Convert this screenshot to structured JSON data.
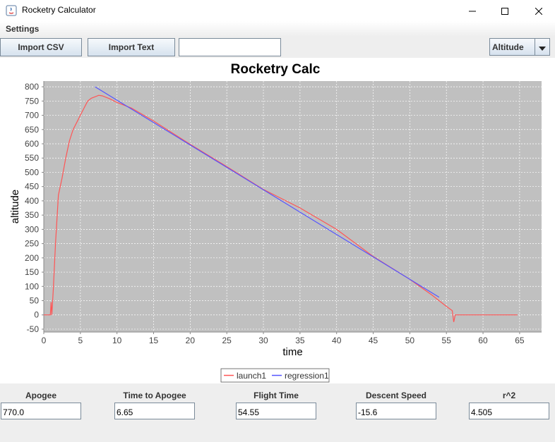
{
  "window": {
    "title": "Rocketry Calculator"
  },
  "menu": {
    "settings_label": "Settings"
  },
  "toolbar": {
    "import_csv_label": "Import CSV",
    "import_text_label": "Import Text",
    "text_value": "",
    "mode_selected": "Altitude"
  },
  "stats": [
    {
      "label": "Apogee",
      "value": "770.0"
    },
    {
      "label": "Time to Apogee",
      "value": "6.65"
    },
    {
      "label": "Flight Time",
      "value": "54.55"
    },
    {
      "label": "Descent Speed",
      "value": "-15.6"
    },
    {
      "label": "r^2",
      "value": "4.505"
    }
  ],
  "colors": {
    "plot_background": "#c0c0c0",
    "gridline": "#ffffff",
    "launch_series": "#ff5555",
    "regression_series": "#5555ff",
    "panel_bg": "#eeeeee"
  },
  "chart_data": {
    "type": "line",
    "title": "Rocketry Calc",
    "xlabel": "time",
    "ylabel": "altitude",
    "xlim": [
      0,
      68
    ],
    "ylim": [
      -60,
      820
    ],
    "xticks": [
      0,
      5,
      10,
      15,
      20,
      25,
      30,
      35,
      40,
      45,
      50,
      55,
      60,
      65
    ],
    "yticks": [
      -50,
      0,
      50,
      100,
      150,
      200,
      250,
      300,
      350,
      400,
      450,
      500,
      550,
      600,
      650,
      700,
      750,
      800
    ],
    "grid": true,
    "legend_position": "bottom-center",
    "series": [
      {
        "name": "launch1",
        "x": [
          0,
          0.9,
          1.0,
          1.1,
          1.3,
          1.6,
          2.0,
          2.5,
          3.0,
          3.5,
          4.0,
          4.5,
          5.0,
          5.5,
          6.0,
          6.5,
          7.0,
          7.5,
          8.0,
          9.0,
          10.0,
          12.0,
          15.0,
          20.0,
          25.0,
          30.0,
          35.0,
          40.0,
          45.0,
          50.0,
          53.0,
          55.0,
          55.8,
          56.0,
          56.2,
          57.0,
          60.0,
          64.7
        ],
        "y": [
          0,
          0,
          45,
          0,
          90,
          250,
          420,
          480,
          550,
          610,
          650,
          675,
          700,
          725,
          750,
          760,
          765,
          770,
          768,
          758,
          745,
          725,
          680,
          598,
          520,
          440,
          375,
          300,
          205,
          125,
          70,
          30,
          15,
          -25,
          0,
          0,
          0,
          0
        ]
      },
      {
        "name": "regression1",
        "x": [
          7.0,
          54.0
        ],
        "y": [
          800,
          62
        ]
      }
    ]
  }
}
